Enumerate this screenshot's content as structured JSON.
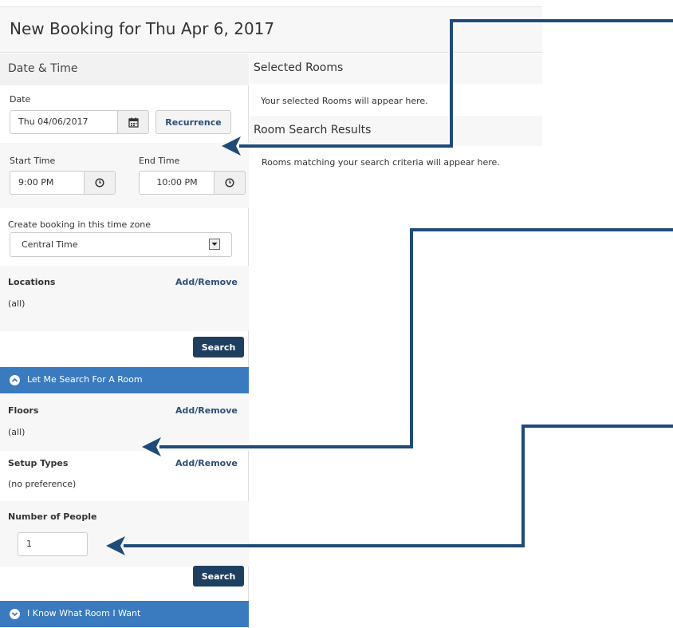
{
  "header": {
    "title": "New Booking for Thu Apr 6, 2017"
  },
  "left": {
    "panel_title": "Date & Time",
    "date": {
      "label": "Date",
      "value": "Thu 04/06/2017",
      "recurrence_label": "Recurrence"
    },
    "start_time": {
      "label": "Start Time",
      "value": "9:00 PM"
    },
    "end_time": {
      "label": "End Time",
      "value": "10:00 PM"
    },
    "timezone": {
      "label": "Create booking in this time zone",
      "value": "Central Time"
    },
    "locations": {
      "label": "Locations",
      "link": "Add/Remove",
      "value": "(all)"
    },
    "search_label": "Search",
    "let_me_search": "Let Me Search For A Room",
    "floors": {
      "label": "Floors",
      "link": "Add/Remove",
      "value": "(all)"
    },
    "setup_types": {
      "label": "Setup Types",
      "link": "Add/Remove",
      "value": "(no preference)"
    },
    "people": {
      "label": "Number of People",
      "value": "1"
    },
    "search_label_2": "Search",
    "know_room": "I Know What Room I Want"
  },
  "right": {
    "selected_title": "Selected Rooms",
    "selected_text": "Your selected Rooms will appear here.",
    "results_title": "Room Search Results",
    "results_text": "Rooms matching your search criteria will appear here."
  },
  "colors": {
    "accent_blue": "#3a7abf",
    "button_dark": "#1f3f61",
    "arrow": "#1f4b78",
    "link": "#2d4f7a"
  },
  "icons": [
    "calendar-icon",
    "clock-icon",
    "dropdown-arrow-icon",
    "chevron-up-circle-icon",
    "chevron-down-circle-icon"
  ]
}
